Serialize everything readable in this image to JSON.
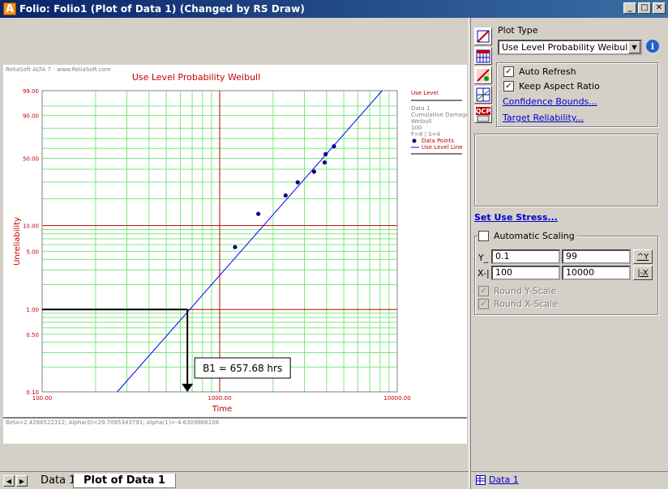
{
  "window": {
    "title": "Folio: Folio1 (Plot of Data 1) (Changed by RS Draw)",
    "app_icon": "A",
    "minimize": "_",
    "maximize": "□",
    "close": "✕"
  },
  "plot": {
    "watermark": "ReliaSoft ALTA 7 - www.ReliaSoft.com",
    "footer_params": "Beta=2.4284522312; Alpha(0)=29.7095343791; Alpha(1)=-4.6309866106",
    "annotation": "B1 = 657.68 hrs",
    "legend": {
      "header": "Use Level",
      "lines": [
        "Data 1",
        "Cumulative Damage",
        "Weibull",
        "100",
        "F=8 | S=4"
      ],
      "points_label": "Data Points",
      "line_label": "Use Level Line"
    }
  },
  "chart_data": {
    "type": "scatter",
    "title": "Use Level Probability Weibull",
    "xlabel": "Time",
    "ylabel": "Unreliability",
    "x_scale": "log",
    "y_scale": "weibull-probability",
    "xlim": [
      100,
      10000
    ],
    "ylim": [
      0.1,
      99
    ],
    "x_ticks": [
      "100.00",
      "1000.00",
      "10000.00"
    ],
    "y_ticks": [
      "0.10",
      "0.50",
      "1.00",
      "5.00",
      "10.00",
      "50.00",
      "90.00",
      "99.00"
    ],
    "grid": true,
    "legend_position": "right",
    "series": [
      {
        "name": "Data Points",
        "kind": "points",
        "color": "#000080",
        "x": [
          1220,
          1650,
          2350,
          2750,
          3400,
          3900,
          3950,
          4400
        ],
        "y": [
          5.6,
          13.6,
          21.7,
          29.8,
          37.9,
          46.0,
          54.0,
          62.1
        ]
      },
      {
        "name": "Use Level Line",
        "kind": "line",
        "color": "#0000ff",
        "x": [
          265,
          8220
        ],
        "y": [
          0.1,
          99
        ]
      }
    ],
    "b1_marker": {
      "x": 657.68,
      "y": 1.0
    }
  },
  "right": {
    "plot_type_label": "Plot Type",
    "plot_type_value": "Use Level Probability Weibull",
    "auto_refresh": "Auto Refresh",
    "keep_aspect": "Keep Aspect Ratio",
    "confidence_bounds": "Confidence Bounds...",
    "target_reliability": "Target Reliability...",
    "set_use_stress": "Set Use Stress...",
    "automatic_scaling": "Automatic Scaling",
    "y_label": "Y_",
    "x_label": "X-|",
    "y_min": "0.1",
    "y_max": "99",
    "x_min": "100",
    "x_max": "10000",
    "y_btn": "^Y",
    "x_btn": "|-X",
    "round_y": "Round Y-Scale",
    "round_x": "Round X-Scale",
    "footer_link": "Data 1",
    "check_mark": "✓"
  },
  "tabs": {
    "items": [
      "Data 1",
      "Plot of Data 1"
    ],
    "prev": "◀",
    "next": "▶"
  },
  "colors": {
    "grid_green": "#7ee87e",
    "grid_red": "#c00000",
    "axis_text": "#c00000",
    "point": "#000080",
    "line": "#0000ff"
  }
}
